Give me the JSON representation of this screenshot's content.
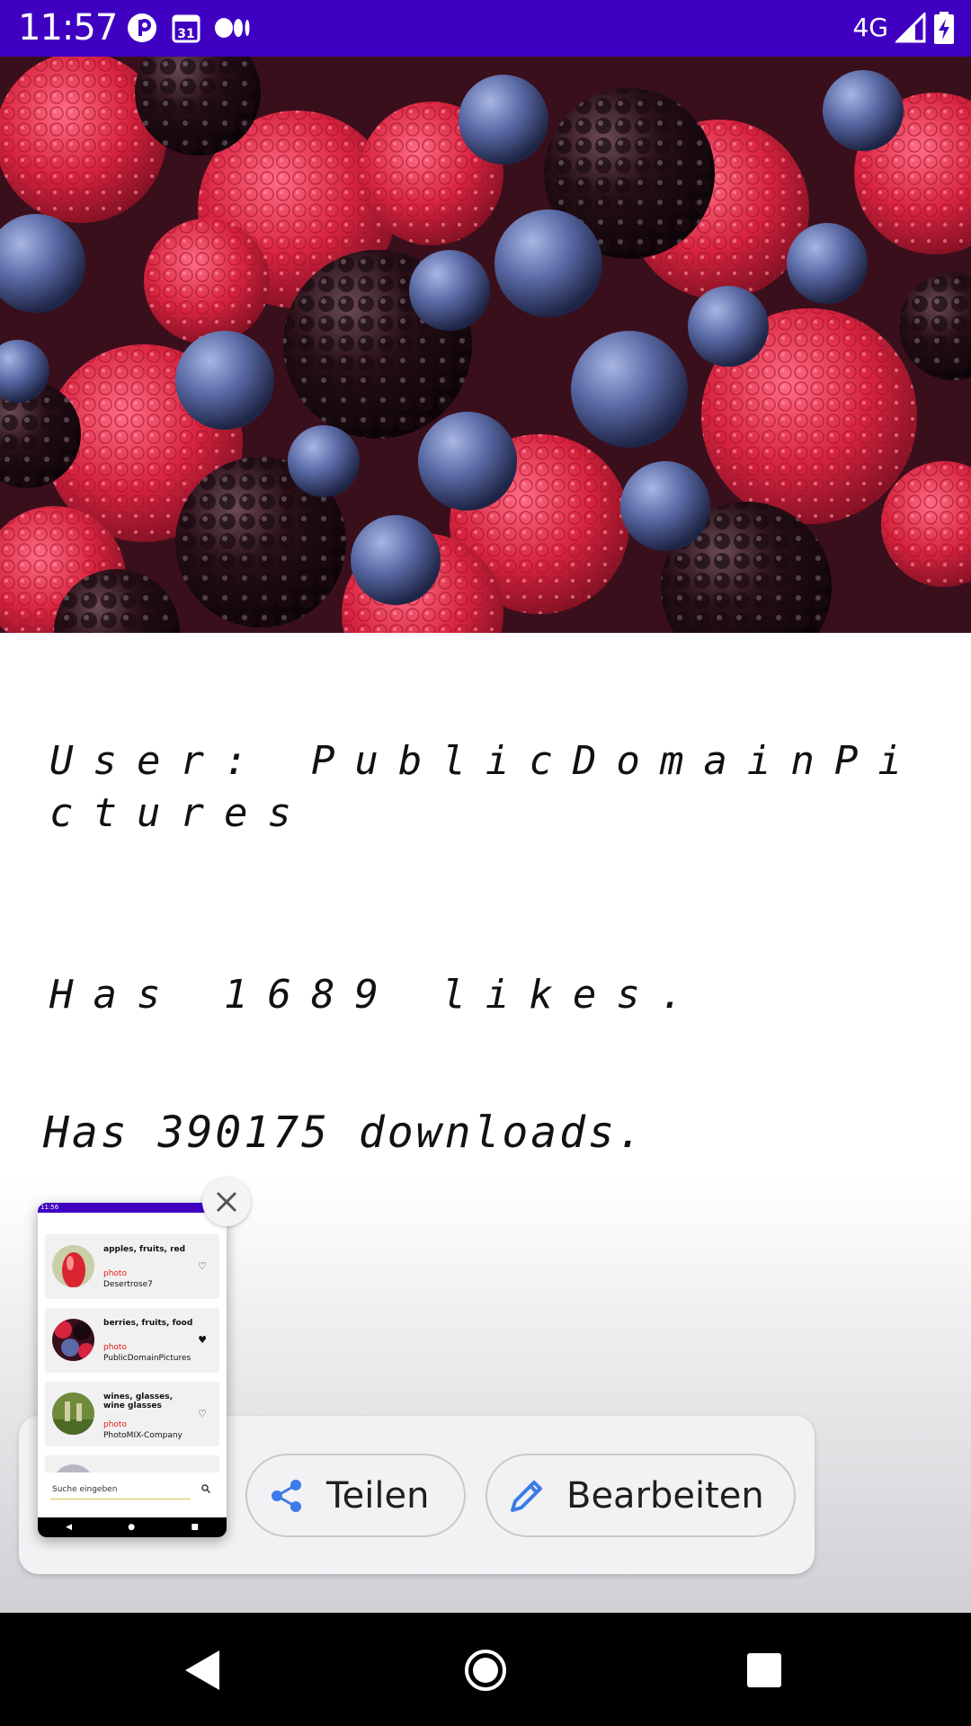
{
  "status_bar": {
    "time": "11:57",
    "network": "4G",
    "icons": [
      "p-app-icon",
      "calendar-icon",
      "medium-icon",
      "signal-icon",
      "battery-charging-icon"
    ],
    "background": "#3f00c2"
  },
  "hero": {
    "image": "berries-photo"
  },
  "details": {
    "user": "User: PublicDomainPictures",
    "likes": "Has 1689 likes.",
    "downloads": "Has 390175 downloads."
  },
  "share_actions": {
    "share_label": "Teilen",
    "edit_label": "Bearbeiten",
    "accent": "#3c7be8"
  },
  "preview": {
    "time": "11:56",
    "items": [
      {
        "title": "apples, fruits, red",
        "type": "photo",
        "user": "Desertrose7",
        "heart": "♡"
      },
      {
        "title": "berries, fruits, food",
        "type": "photo",
        "user": "PublicDomainPictures",
        "heart": "♥"
      },
      {
        "title": "wines, glasses, wine glasses",
        "type": "photo",
        "user": "PhotoMIX-Company",
        "heart": "♡"
      }
    ],
    "search_placeholder": "Suche eingeben"
  }
}
